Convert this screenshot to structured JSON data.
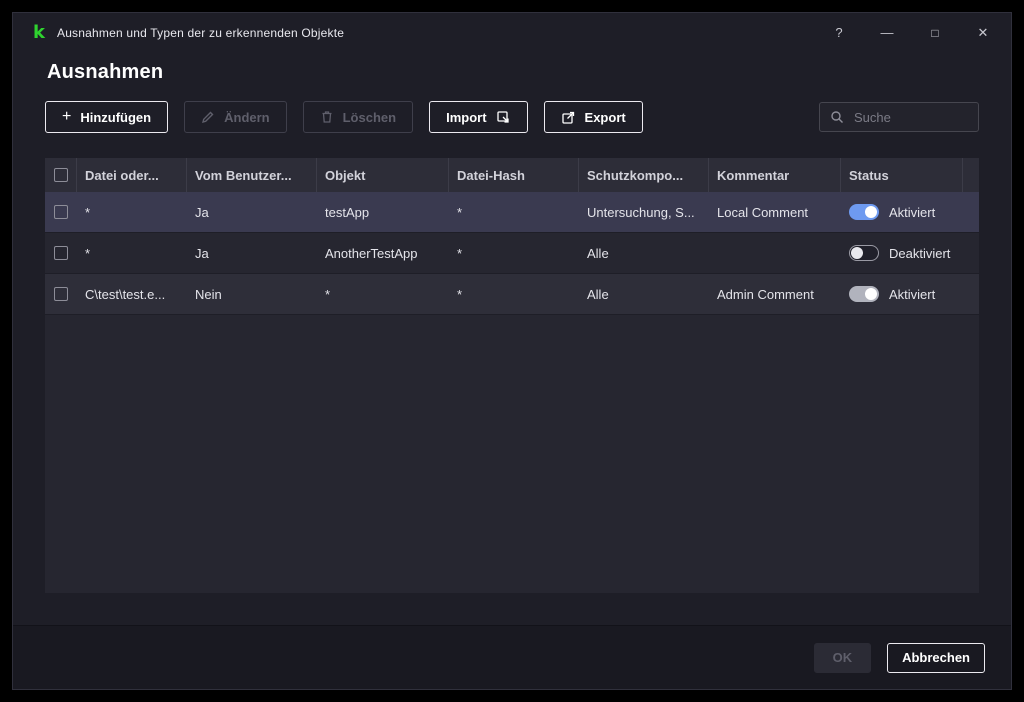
{
  "window": {
    "title": "Ausnahmen und Typen der zu erkennenden Objekte",
    "controls": {
      "help": "?",
      "minimize": "—",
      "maximize": "□",
      "close": "✕"
    },
    "brand_color": "#2fd32f"
  },
  "page": {
    "title": "Ausnahmen"
  },
  "toolbar": {
    "add_label": "Hinzufügen",
    "edit_label": "Ändern",
    "delete_label": "Löschen",
    "import_label": "Import",
    "export_label": "Export",
    "search_placeholder": "Suche"
  },
  "table": {
    "columns": [
      "Datei oder...",
      "Vom Benutzer...",
      "Objekt",
      "Datei-Hash",
      "Schutzkompo...",
      "Kommentar",
      "Status"
    ],
    "rows": [
      {
        "selected": true,
        "cells": [
          "*",
          "Ja",
          "testApp",
          "*",
          "Untersuchung, S...",
          "Local Comment"
        ],
        "status": {
          "label": "Aktiviert",
          "state": "on",
          "color": "#6e9af0"
        }
      },
      {
        "selected": false,
        "cells": [
          "*",
          "Ja",
          "AnotherTestApp",
          "*",
          "Alle",
          ""
        ],
        "status": {
          "label": "Deaktiviert",
          "state": "off",
          "color": "#20202a"
        }
      },
      {
        "selected": false,
        "cells": [
          "C\\test\\test.e...",
          "Nein",
          "*",
          "*",
          "Alle",
          "Admin Comment"
        ],
        "status": {
          "label": "Aktiviert",
          "state": "on",
          "color": "#b1b3bd"
        }
      }
    ]
  },
  "footer": {
    "ok_label": "OK",
    "cancel_label": "Abbrechen"
  }
}
